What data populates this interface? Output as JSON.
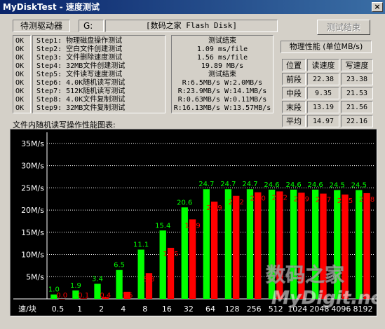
{
  "window": {
    "title": "MyDiskTest - 速度测试",
    "close_label": "×"
  },
  "toolbar": {
    "drive_label": "待测驱动器",
    "drive_letter": "G:",
    "drive_name": "[数码之家 Flash Disk]",
    "finish_button": "测试结束"
  },
  "steps": {
    "status": [
      "OK",
      "OK",
      "OK",
      "OK",
      "OK",
      "OK",
      "OK",
      "OK",
      "OK"
    ],
    "labels": [
      "Step1: 物理磁盘操作测试",
      "Step2: 空白文件创建测试",
      "Step3: 文件删除速度测试",
      "Step4: 32MB文件创建测试",
      "Step5: 文件读写速度测试",
      "Step6: 4.0K随机读写测试",
      "Step7: 512K随机读写测试",
      "Step8: 4.0K文件复制测试",
      "Step9: 32MB文件复制测试"
    ],
    "results": [
      "测试结束",
      "1.09 ms/file",
      "1.56 ms/file",
      "19.89 MB/s",
      "测试结束",
      "R:6.5MB/s W:2.0MB/s",
      "R:23.9MB/s W:14.1MB/s",
      "R:0.63MB/s W:0.11MB/s",
      "R:16.13MB/s W:13.57MB/s"
    ]
  },
  "physical": {
    "title": "物理性能 (单位MB/s)",
    "col_position": "位置",
    "col_read": "读速度",
    "col_write": "写速度",
    "rows": [
      {
        "label": "前段",
        "read": "22.38",
        "write": "23.38"
      },
      {
        "label": "中段",
        "read": "9.35",
        "write": "21.53"
      },
      {
        "label": "末段",
        "read": "13.19",
        "write": "21.56"
      },
      {
        "label": "平均",
        "read": "14.97",
        "write": "22.16"
      }
    ]
  },
  "chart_caption": "文件内随机读写操作性能图表:",
  "watermark": {
    "line1": "数码之家",
    "line2": "MyDigit.net"
  },
  "chart_data": {
    "type": "bar",
    "xlabel": "速/块",
    "categories": [
      "0.5",
      "1",
      "2",
      "4",
      "8",
      "16",
      "32",
      "64",
      "128",
      "256",
      "512",
      "1024",
      "2048",
      "4096",
      "8192"
    ],
    "series": [
      {
        "values": [
          1.0,
          1.9,
          3.4,
          6.5,
          11.1,
          15.4,
          20.6,
          24.7,
          24.7,
          24.7,
          24.6,
          24.6,
          24.6,
          24.5,
          24.5
        ]
      },
      {
        "values": [
          0.0,
          0.1,
          0.4,
          1.6,
          5.8,
          11.5,
          17.9,
          21.9,
          23.2,
          24.0,
          24.2,
          23.9,
          23.7,
          23.5,
          23.8
        ]
      }
    ],
    "series_labels": [
      [
        "1.0",
        "1.9",
        "3.4",
        "6.5",
        "11.1",
        "15.4",
        "20.6",
        "24.7",
        "24.7",
        "24.7",
        "24.6",
        "24.6",
        "24.6",
        "24.5",
        "24.5"
      ],
      [
        "0.0",
        "0.1",
        "0.4",
        "1.6",
        "5.8",
        "11.5",
        "17.9",
        "21.9",
        "23.2",
        "24.0",
        "24.2",
        "23.9",
        "23.7",
        "23.5",
        "23.8"
      ]
    ],
    "yticks": [
      "35M/s",
      "30M/s",
      "25M/s",
      "20M/s",
      "15M/s",
      "10M/s",
      "5M/s"
    ],
    "ytick_values": [
      35,
      30,
      25,
      20,
      15,
      10,
      5
    ],
    "ylim": [
      0,
      37.5
    ],
    "colors": {
      "read": "#00ff00",
      "write": "#ff0000",
      "grid": "#ffffff",
      "label_read": "#00ff00",
      "label_write": "#ff0000"
    }
  }
}
